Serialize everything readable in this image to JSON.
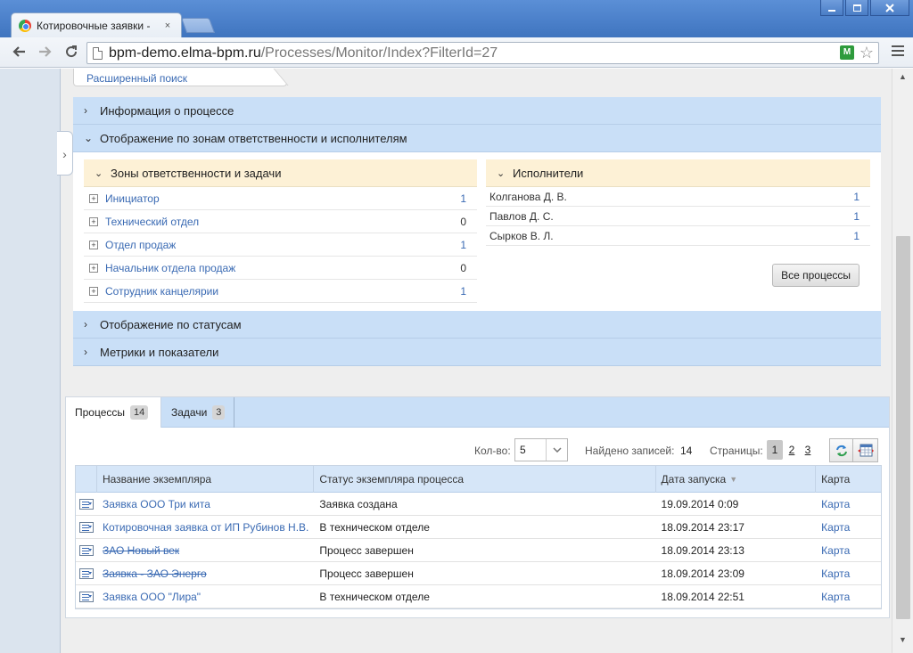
{
  "browser": {
    "tab_title": "Котировочные заявки -",
    "tab_close": "×",
    "url_host": "bpm-demo.elma-bpm.ru",
    "url_path": "/Processes/Monitor/Index?FilterId=27",
    "ext_label": "M"
  },
  "page": {
    "advanced_search": "Расширенный поиск",
    "accordion": {
      "process_info": "Информация о процессе",
      "by_zones": "Отображение по зонам ответственности и исполнителям",
      "by_status": "Отображение по статусам",
      "metrics": "Метрики и показатели"
    },
    "zones": {
      "title": "Зоны ответственности и задачи",
      "items": [
        {
          "name": "Инициатор",
          "count": "1",
          "link": true
        },
        {
          "name": "Технический отдел",
          "count": "0",
          "link": false
        },
        {
          "name": "Отдел продаж",
          "count": "1",
          "link": true
        },
        {
          "name": "Начальник отдела продаж",
          "count": "0",
          "link": false
        },
        {
          "name": "Сотрудник канцелярии",
          "count": "1",
          "link": true
        }
      ]
    },
    "executors": {
      "title": "Исполнители",
      "items": [
        {
          "name": "Колганова Д. В.",
          "count": "1"
        },
        {
          "name": "Павлов Д. С.",
          "count": "1"
        },
        {
          "name": "Сырков В. Л.",
          "count": "1"
        }
      ],
      "all_processes_button": "Все процессы"
    },
    "tabs": [
      {
        "label": "Процессы",
        "badge": "14"
      },
      {
        "label": "Задачи",
        "badge": "3"
      }
    ],
    "pager": {
      "count_label": "Кол-во:",
      "count_value": "5",
      "found_label": "Найдено записей:",
      "found_value": "14",
      "pages_label": "Страницы:",
      "pages": [
        "1",
        "2",
        "3"
      ]
    },
    "grid": {
      "headers": [
        "Название экземпляра",
        "Статус экземпляра процесса",
        "Дата запуска",
        "Карта"
      ],
      "rows": [
        {
          "name": "Заявка ООО Три кита",
          "status": "Заявка создана",
          "date": "19.09.2014 0:09",
          "map": "Карта"
        },
        {
          "name": "Котировочная заявка от ИП Рубинов Н.В.",
          "status": "В техническом отделе",
          "date": "18.09.2014 23:17",
          "map": "Карта"
        },
        {
          "name": "ЗАО Новый век",
          "status": "Процесс завершен",
          "date": "18.09.2014 23:13",
          "map": "Карта"
        },
        {
          "name": "Заявка - ЗАО Энерго",
          "status": "Процесс завершен",
          "date": "18.09.2014 23:09",
          "map": "Карта"
        },
        {
          "name": "Заявка ООО \"Лира\"",
          "status": "В техническом отделе",
          "date": "18.09.2014 22:51",
          "map": "Карта"
        }
      ]
    }
  }
}
